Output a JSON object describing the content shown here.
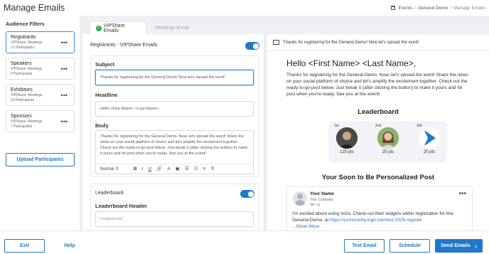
{
  "header": {
    "page_title": "Manage Emails",
    "breadcrumbs": [
      "Events",
      "General Demo",
      "Manage Emails"
    ]
  },
  "sidebar": {
    "title": "Audience Filters",
    "items": [
      {
        "name": "Registrants",
        "filter": "VIPShare, Meetings",
        "count": "21 Participants"
      },
      {
        "name": "Speakers",
        "filter": "VIPShare, Meetings",
        "count": "0 Participants"
      },
      {
        "name": "Exhibitors",
        "filter": "VIPShare, Meetings",
        "count": "13 Participants"
      },
      {
        "name": "Sponsors",
        "filter": "VIPShare, Meetings",
        "count": "7 Participants"
      }
    ],
    "upload_label": "Upload Participants"
  },
  "tabs": [
    "VIPShare Emails",
    "Meetings Email"
  ],
  "form": {
    "section_title": "Registrants - VIPShare Emails",
    "subject_label": "Subject",
    "subject_value": "Thanks for registering for the General Demo! Now let's spread the word!",
    "headline_label": "Headline",
    "headline_value": "Hello <First Name> <Last Name>,",
    "body_label": "Body",
    "body_value": "Thanks for registering for the General Demo. Now, let's spread the word! Share the news on your social platform of choice and let's amplify the excitement together. Check out the ready-to-go post below. Just tweak it (after clicking the button) to make it yours and hit post when you're ready. See you at the event!",
    "rte_format": "Normal",
    "leaderboard_label": "Leaderboard",
    "leaderboard_header_label": "Leaderboard Header",
    "leaderboard_header_placeholder": "Leaderboard"
  },
  "preview": {
    "subject": "Thanks for registering for the General Demo! Now let's spread the word!",
    "greeting": "Hello <First Name> <Last Name>,",
    "body": "Thanks for registering for the General Demo. Now, let's spread the word! Share the news on your social platform of choice and let's amplify the excitement together. Check out the ready-to-go post below. Just tweak it (after clicking the button) to make it yours and hit post when you're ready. See you at the event!",
    "leaderboard_title": "Leaderboard",
    "leaderboard": [
      {
        "rank": "1st",
        "points": "125 pts"
      },
      {
        "rank": "2nd",
        "points": "25 pts"
      },
      {
        "rank": "3rd",
        "points": "20 pts"
      }
    ],
    "post_title": "Your Soon to Be Personalized Post",
    "post": {
      "name": "Your Name",
      "company": "Your Company",
      "time": "3d •",
      "text": "I'm excited about using InGo. Check out their widgets within registration for this General Demo, at",
      "link": "https://community.ingo.me/next-2026-register",
      "more": "...Show More"
    }
  },
  "footer": {
    "exit": "Exit",
    "help": "Help",
    "test_email": "Test Email",
    "schedule": "Schedule",
    "send": "Send Emails"
  },
  "colors": {
    "accent": "#1f79c9",
    "success": "#2eaa4a"
  }
}
